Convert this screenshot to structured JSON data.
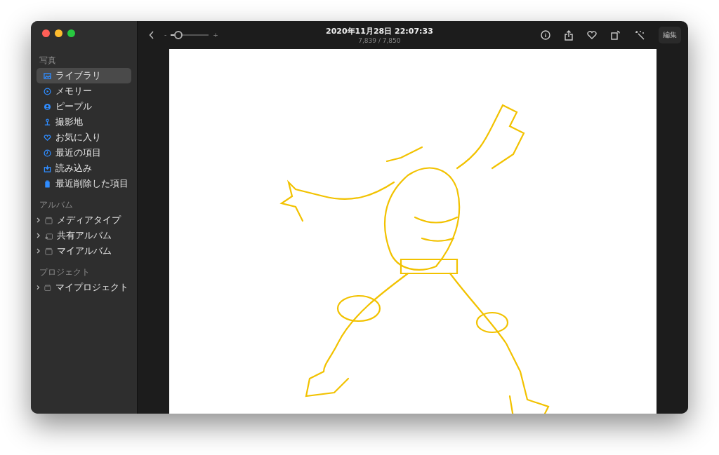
{
  "window": {
    "title": "2020年11月28日 22:07:33",
    "subtitle": "7,839 / 7,850"
  },
  "toolbar": {
    "zoom_minus": "-",
    "zoom_plus": "+",
    "zoom": {
      "level": 0.2
    },
    "edit_button": "編集"
  },
  "sidebar": {
    "sections": [
      {
        "title": "写真",
        "items": [
          {
            "label": "ライブラリ",
            "selected": true
          },
          {
            "label": "メモリー",
            "selected": false
          },
          {
            "label": "ピープル",
            "selected": false
          },
          {
            "label": "撮影地",
            "selected": false
          },
          {
            "label": "お気に入り",
            "selected": false
          },
          {
            "label": "最近の項目",
            "selected": false
          },
          {
            "label": "読み込み",
            "selected": false
          },
          {
            "label": "最近削除した項目",
            "selected": false
          }
        ]
      },
      {
        "title": "アルバム",
        "items": [
          {
            "label": "メディアタイプ",
            "selected": false,
            "expanded": false
          },
          {
            "label": "共有アルバム",
            "selected": false,
            "expanded": false
          },
          {
            "label": "マイアルバム",
            "selected": false,
            "expanded": false
          }
        ]
      },
      {
        "title": "プロジェクト",
        "items": [
          {
            "label": "マイプロジェクト",
            "selected": false,
            "expanded": false
          }
        ]
      }
    ]
  }
}
